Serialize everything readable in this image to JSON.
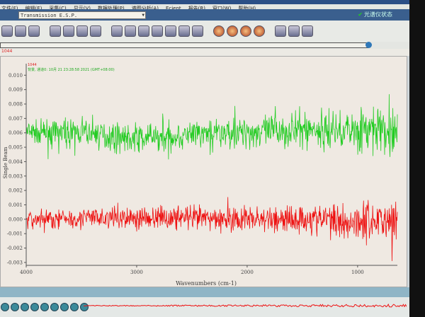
{
  "menubar": {
    "items": [
      "文件(F)",
      "编辑(E)",
      "采集(C)",
      "显示(V)",
      "数据处理(P)",
      "谱图分析(A)",
      "Ecient",
      "报告(R)",
      "窗口(W)",
      "帮助(H)"
    ]
  },
  "experiment_combo": {
    "value": "Transmission E.S.P."
  },
  "status": {
    "label": "光谱仪状态"
  },
  "spectrum_label": "1044",
  "bottom_status": "",
  "chart_data": {
    "type": "line",
    "xlabel": "Wavenumbers (cm-1)",
    "ylabel": "Single Beam",
    "xlim": [
      4000,
      640
    ],
    "ylim": [
      -0.0032,
      0.0108
    ],
    "x_ticks": [
      "4000",
      "3000",
      "2000",
      "1000"
    ],
    "y_ticks": [
      "0.010",
      "0.009",
      "0.008",
      "0.007",
      "0.006",
      "0.005",
      "0.004",
      "0.003",
      "0.002",
      "0.001",
      "0.000",
      "-0.001",
      "-0.002",
      "-0.003"
    ],
    "legend_header": "1044",
    "legend_text": "背景, 通道0: 10月 21 23:28:58 2021 (GMT+08:00)",
    "series": [
      {
        "color": "#22cc22",
        "x": [
          4000,
          3500,
          3000,
          2600,
          2200,
          1800,
          1400,
          1000,
          640
        ],
        "mean": [
          0.006,
          0.006,
          0.0056,
          0.0058,
          0.006,
          0.0061,
          0.0062,
          0.0062,
          0.006
        ],
        "spread": [
          0.0012,
          0.0013,
          0.0015,
          0.0015,
          0.0016,
          0.0017,
          0.0019,
          0.0022,
          0.0028
        ]
      },
      {
        "color": "#ee1111",
        "x": [
          4000,
          3500,
          3000,
          2600,
          2200,
          1800,
          1400,
          1000,
          640
        ],
        "mean": [
          0.0,
          0.0001,
          0.0001,
          0.0001,
          0.0,
          0.0,
          0.0,
          -0.0001,
          0.0
        ],
        "spread": [
          0.001,
          0.0011,
          0.0012,
          0.0012,
          0.0013,
          0.0014,
          0.0016,
          0.002,
          0.003
        ]
      }
    ]
  },
  "colors": {
    "accent": "#3a5f8e",
    "plot_bg": "#efe9e2"
  }
}
